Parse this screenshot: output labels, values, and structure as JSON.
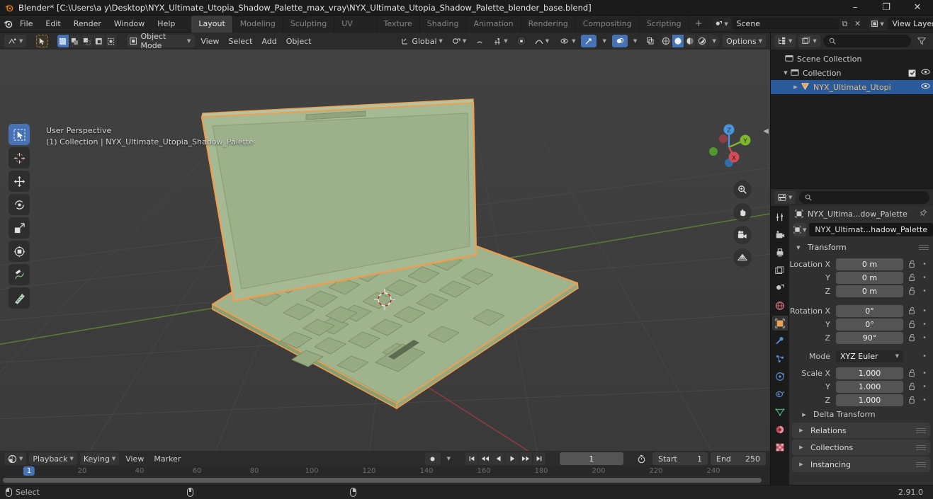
{
  "window": {
    "title": "Blender* [C:\\Users\\a y\\Desktop\\NYX_Ultimate_Utopia_Shadow_Palette_max_vray\\NYX_Ultimate_Utopia_Shadow_Palette_blender_base.blend]",
    "minimize": "–",
    "maximize": "❐",
    "close": "✕"
  },
  "menu": {
    "items": [
      "File",
      "Edit",
      "Render",
      "Window",
      "Help"
    ]
  },
  "workspaces": {
    "tabs": [
      "Layout",
      "Modeling",
      "Sculpting",
      "UV Editing",
      "Texture Paint",
      "Shading",
      "Animation",
      "Rendering",
      "Compositing",
      "Scripting"
    ],
    "active": "Layout",
    "add_label": "+"
  },
  "scene_selector": {
    "value": "Scene",
    "new_label": "⧉",
    "unlink_label": "✕"
  },
  "viewlayer_selector": {
    "value": "View Layer",
    "new_label": "⧉",
    "unlink_label": "✕"
  },
  "viewport_header": {
    "mode": "Object Mode",
    "menus": [
      "View",
      "Select",
      "Add",
      "Object"
    ],
    "orientation": "Global",
    "options": "Options"
  },
  "viewport": {
    "perspective": "User Perspective",
    "collection_line": "(1) Collection | NYX_Ultimate_Utopia_Shadow_Palette",
    "gizmo_axes": [
      "X",
      "Y",
      "Z"
    ],
    "tools": [
      "select-box-tool",
      "cursor-tool",
      "move-tool",
      "rotate-tool",
      "scale-tool",
      "transform-tool",
      "annotate-tool",
      "measure-tool"
    ],
    "nav_buttons": [
      "zoom-nav-icon",
      "pan-nav-icon",
      "camera-nav-icon",
      "grid-nav-icon"
    ],
    "object_color": "#9fb38c",
    "outline_color": "#ed9e4e"
  },
  "outliner": {
    "display_mode": "View Layer",
    "search_placeholder": "",
    "rows": [
      {
        "label": "Scene Collection",
        "icon": "collection-icon",
        "indent": 0,
        "selected": false,
        "has_disclosure": false,
        "checkbox": false,
        "eye": false
      },
      {
        "label": "Collection",
        "icon": "collection-icon",
        "indent": 1,
        "selected": false,
        "has_disclosure": true,
        "checkbox": true,
        "eye": true
      },
      {
        "label": "NYX_Ultimate_Utopi",
        "icon": "mesh-icon",
        "indent": 2,
        "selected": true,
        "has_disclosure": true,
        "checkbox": false,
        "eye": true
      }
    ]
  },
  "properties": {
    "search_placeholder": "",
    "breadcrumb": "NYX_Ultima...dow_Palette",
    "object_name": "NYX_Ultimat...hadow_Palette",
    "tabs": [
      "tool-tab",
      "render-tab",
      "output-tab",
      "view-layer-tab",
      "scene-tab",
      "world-tab",
      "object-tab",
      "modifier-tab",
      "particles-tab",
      "physics-tab",
      "constraints-tab",
      "data-tab",
      "material-tab",
      "texture-tab"
    ],
    "active_tab": "object-tab",
    "transform": {
      "title": "Transform",
      "location": {
        "label": "Location X",
        "labels": [
          "Location X",
          "Y",
          "Z"
        ],
        "values": [
          "0 m",
          "0 m",
          "0 m"
        ]
      },
      "rotation": {
        "labels": [
          "Rotation X",
          "Y",
          "Z"
        ],
        "values": [
          "0°",
          "0°",
          "90°"
        ]
      },
      "mode": {
        "label": "Mode",
        "value": "XYZ Euler"
      },
      "scale": {
        "labels": [
          "Scale X",
          "Y",
          "Z"
        ],
        "values": [
          "1.000",
          "1.000",
          "1.000"
        ]
      },
      "delta": "Delta Transform"
    },
    "panels": [
      "Relations",
      "Collections",
      "Instancing"
    ]
  },
  "timeline": {
    "editor_type": "timeline-editor-icon",
    "menus": [
      "Playback",
      "Keying",
      "View",
      "Marker"
    ],
    "current_frame": "1",
    "start_label": "Start",
    "start_value": "1",
    "end_label": "End",
    "end_value": "250",
    "ruler_ticks": [
      "20",
      "40",
      "60",
      "80",
      "100",
      "120",
      "140",
      "160",
      "180",
      "200",
      "220",
      "240"
    ],
    "playhead_label": "1"
  },
  "statusbar": {
    "select_label": "Select",
    "version": "2.91.0"
  }
}
